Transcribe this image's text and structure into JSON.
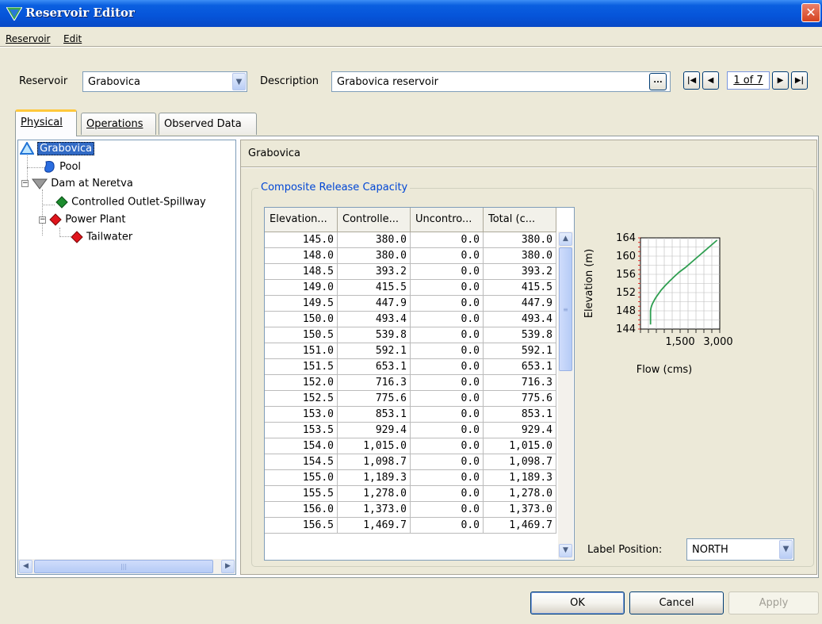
{
  "window": {
    "title": "Reservoir Editor",
    "close_glyph": "✕"
  },
  "menu": {
    "items": [
      "Reservoir",
      "Edit"
    ]
  },
  "toolbar": {
    "reservoir_label": "Reservoir",
    "reservoir_value": "Grabovica",
    "description_label": "Description",
    "description_value": "Grabovica reservoir",
    "ellipsis_label": "...",
    "nav_text": "1 of 7"
  },
  "tabs": [
    {
      "label": "Physical",
      "active": true
    },
    {
      "label": "Operations",
      "active": false
    },
    {
      "label": "Observed Data",
      "active": false
    }
  ],
  "tree": {
    "nodes": [
      {
        "label": "Grabovica",
        "icon": "triangle-reservoir-icon",
        "selected": true
      },
      {
        "label": "Pool",
        "icon": "pool-icon"
      },
      {
        "label": "Dam at Neretva",
        "icon": "dam-icon"
      },
      {
        "label": "Controlled Outlet-Spillway",
        "icon": "green-diamond-icon"
      },
      {
        "label": "Power Plant",
        "icon": "red-diamond-icon"
      },
      {
        "label": "Tailwater",
        "icon": "red-diamond-icon"
      }
    ]
  },
  "pane": {
    "title": "Grabovica",
    "group_title": "Composite Release Capacity"
  },
  "table": {
    "columns": [
      "Elevation...",
      "Controlle...",
      "Uncontro...",
      "Total (c..."
    ],
    "rows": [
      [
        "145.0",
        "380.0",
        "0.0",
        "380.0"
      ],
      [
        "148.0",
        "380.0",
        "0.0",
        "380.0"
      ],
      [
        "148.5",
        "393.2",
        "0.0",
        "393.2"
      ],
      [
        "149.0",
        "415.5",
        "0.0",
        "415.5"
      ],
      [
        "149.5",
        "447.9",
        "0.0",
        "447.9"
      ],
      [
        "150.0",
        "493.4",
        "0.0",
        "493.4"
      ],
      [
        "150.5",
        "539.8",
        "0.0",
        "539.8"
      ],
      [
        "151.0",
        "592.1",
        "0.0",
        "592.1"
      ],
      [
        "151.5",
        "653.1",
        "0.0",
        "653.1"
      ],
      [
        "152.0",
        "716.3",
        "0.0",
        "716.3"
      ],
      [
        "152.5",
        "775.6",
        "0.0",
        "775.6"
      ],
      [
        "153.0",
        "853.1",
        "0.0",
        "853.1"
      ],
      [
        "153.5",
        "929.4",
        "0.0",
        "929.4"
      ],
      [
        "154.0",
        "1,015.0",
        "0.0",
        "1,015.0"
      ],
      [
        "154.5",
        "1,098.7",
        "0.0",
        "1,098.7"
      ],
      [
        "155.0",
        "1,189.3",
        "0.0",
        "1,189.3"
      ],
      [
        "155.5",
        "1,278.0",
        "0.0",
        "1,278.0"
      ],
      [
        "156.0",
        "1,373.0",
        "0.0",
        "1,373.0"
      ],
      [
        "156.5",
        "1,469.7",
        "0.0",
        "1,469.7"
      ]
    ]
  },
  "chart_data": {
    "type": "line",
    "xlabel": "Flow (cms)",
    "ylabel": "Elevation (m)",
    "ylim": [
      144,
      164
    ],
    "xlim": [
      0,
      3000
    ],
    "yticks": [
      "164",
      "160",
      "156",
      "152",
      "148",
      "144"
    ],
    "xticks": [
      "1,500",
      "3,000"
    ],
    "grid": true,
    "series": [
      {
        "color": "#2e9e50",
        "x": [
          380,
          380,
          393.2,
          415.5,
          447.9,
          493.4,
          539.8,
          592.1,
          653.1,
          716.3,
          775.6,
          853.1,
          929.4,
          1015,
          1098.7,
          1189.3,
          1278,
          1373,
          1469.7,
          1700,
          2000,
          2300,
          2600,
          2900
        ],
        "y": [
          145,
          148,
          148.5,
          149,
          149.5,
          150,
          150.5,
          151,
          151.5,
          152,
          152.5,
          153,
          153.5,
          154,
          154.5,
          155,
          155.5,
          156,
          156.5,
          157.5,
          159,
          160.5,
          162,
          163.5
        ]
      }
    ]
  },
  "label_position": {
    "label": "Label Position:",
    "value": "NORTH"
  },
  "buttons": {
    "ok": "OK",
    "cancel": "Cancel",
    "apply": "Apply"
  }
}
